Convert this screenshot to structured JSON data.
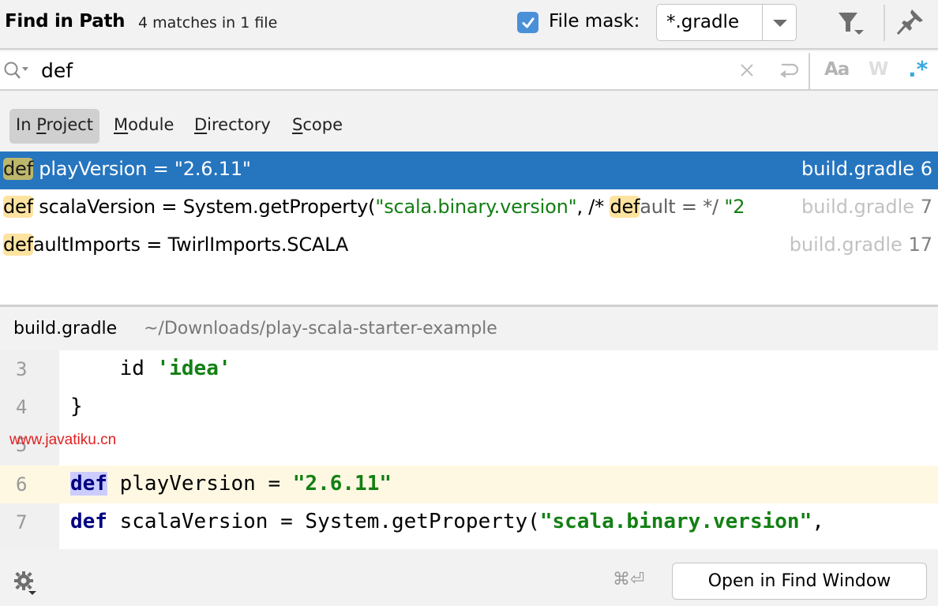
{
  "header": {
    "title": "Find in Path",
    "summary": "4 matches in 1 file",
    "file_mask_checked": true,
    "file_mask_label": "File mask:",
    "file_mask_value": "*.gradle"
  },
  "search": {
    "query": "def",
    "options": {
      "match_case": "Aa",
      "words": "W",
      "regex": ".*"
    }
  },
  "scopes": {
    "items": [
      {
        "pre": "In ",
        "mnemonic": "P",
        "post": "roject",
        "active": true
      },
      {
        "pre": "",
        "mnemonic": "M",
        "post": "odule",
        "active": false
      },
      {
        "pre": "",
        "mnemonic": "D",
        "post": "irectory",
        "active": false
      },
      {
        "pre": "",
        "mnemonic": "S",
        "post": "cope",
        "active": false
      }
    ]
  },
  "results": [
    {
      "match": "def",
      "code_rest": " playVersion = \"2.6.11\"",
      "file": "build.gradle",
      "line": "6",
      "selected": true
    },
    {
      "match": "def",
      "code_a": " scalaVersion = System.getProperty(",
      "string_a": "\"scala.binary.version\"",
      "code_b": ", /* ",
      "match_b": "def",
      "comment_b": "ault = */ ",
      "string_b": "\"2",
      "file": "build.gradle",
      "line": "7",
      "selected": false
    },
    {
      "match": "def",
      "code_rest": "aultImports = TwirlImports.SCALA",
      "file": "build.gradle",
      "line": "17",
      "selected": false
    }
  ],
  "preview": {
    "file_name": "build.gradle",
    "path": "~/Downloads/play-scala-starter-example",
    "lines": [
      {
        "num": "3",
        "indent": "    ",
        "code": "id ",
        "string": "'idea'"
      },
      {
        "num": "4",
        "code": "}"
      },
      {
        "num": "5",
        "code": ""
      },
      {
        "num": "6",
        "keyword": "def",
        "code": " playVersion = ",
        "string": "\"2.6.11\"",
        "current": true
      },
      {
        "num": "7",
        "keyword": "def",
        "code": " scalaVersion = System.getProperty(",
        "string": "\"scala.binary.version\"",
        "tail": ","
      }
    ]
  },
  "watermark": "www.javatiku.cn",
  "footer": {
    "shortcut": "⌘⏎",
    "open_button": "Open in Find Window"
  },
  "colors": {
    "selection": "#2675bf",
    "match_highlight": "#fde3a0",
    "string": "#137e13",
    "keyword": "#000080",
    "checkbox": "#4a90d9",
    "regex_active": "#3aa8de"
  }
}
